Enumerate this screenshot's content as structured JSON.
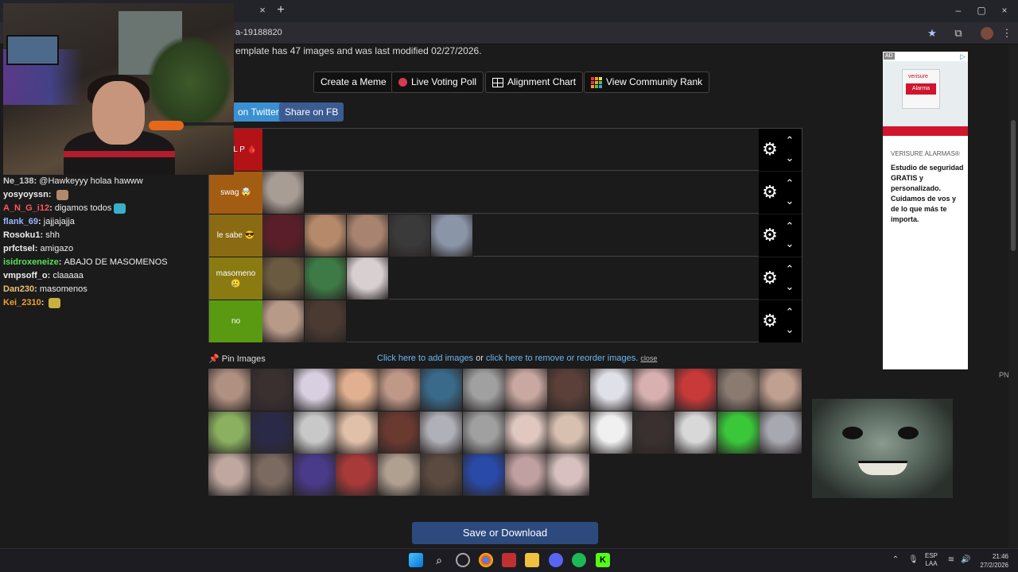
{
  "browser": {
    "url": "a-19188820",
    "tab_close": "×",
    "new_tab": "+",
    "window_controls": [
      "–",
      "▢",
      "×"
    ],
    "toolbar_icons": [
      "star-icon",
      "extensions-icon",
      "profile-icon",
      "menu-icon"
    ]
  },
  "page": {
    "template_info": "emplate has 47 images and was last modified 02/27/2026.",
    "actions": {
      "create_meme": "Create a Meme",
      "live_voting": "Live Voting Poll",
      "alignment_chart": "Alignment Chart",
      "community_rank": "View Community Rank"
    },
    "share": {
      "twitter": "on Twitter",
      "facebook": "Share on FB"
    },
    "tiers": [
      {
        "label": "S DEL P 🩸",
        "color": "#b31217",
        "items": [
          "#00000000"
        ]
      },
      {
        "label": "swag 🤯",
        "color": "#a35d12",
        "items": [
          "#a79d95"
        ]
      },
      {
        "label": "le sabe 😎",
        "color": "#8a6a12",
        "items": [
          "#5a1e2a",
          "#b58a6a",
          "#a88370",
          "#3a3a3a",
          "#8a95a8"
        ]
      },
      {
        "label": "masomeno 🥲",
        "color": "#8a7a12",
        "items": [
          "#6a5a40",
          "#3d7a45",
          "#d8d0d0"
        ]
      },
      {
        "label": "no",
        "color": "#5a9a12",
        "items": [
          "#b89a88",
          "#4a3a32"
        ]
      }
    ],
    "pin": {
      "label": "Pin Images",
      "add_link": "Click here to add images",
      "or": "or",
      "reorder_link": "click here to remove or reorder images.",
      "close": "close"
    },
    "pool": [
      "#b09080",
      "#3a3030",
      "#d8d0e0",
      "#e0b090",
      "#c09888",
      "#3a6a8a",
      "#a0a0a0",
      "#c8a8a0",
      "#5a4038",
      "#e0e0e8",
      "#d8b0b0",
      "#c83a3a",
      "#8a7a70",
      "#c0a090",
      "#8ab060",
      "#2a2a48",
      "#c8c8c8",
      "#e0c0a8",
      "#6a3a30",
      "#b0b0b8",
      "#a0a0a0",
      "#e0c8c0",
      "#d8c0b0",
      "#f0f0f0",
      "#3a3030",
      "#d8d8d8",
      "#3ac83a",
      "#a8a8b0",
      "#c0a8a0",
      "#7a6a60",
      "#4a3a8a",
      "#a83a3a",
      "#b0a090",
      "#5a4a40",
      "#2a4aa8",
      "#c0a0a0",
      "#d8c0c0"
    ],
    "save": "Save or Download"
  },
  "ad": {
    "badge": "AD",
    "choices": "▷",
    "brand_img": "verisure",
    "img_label": "Alarma",
    "sponsor": "VERISURE ALARMAS®",
    "copy": "Estudio de seguridad GRATIS y personalizado. Cuidamos de vos y de lo que más te importa."
  },
  "side_label": "PN",
  "chat": [
    {
      "user": "Ne_138",
      "msg": "@Hawkeyyy holaa hawww",
      "color": "#cfcfcf"
    },
    {
      "user": "yosyoyssn",
      "msg": "",
      "color": "#eeeeee",
      "emote": "#b08a6a"
    },
    {
      "user": "A_N_G_i12",
      "msg": "digamos todos",
      "color": "#ff5a5a",
      "emote": "#3ab0c8"
    },
    {
      "user": "flank_69",
      "msg": "jajjajajja",
      "color": "#9ab8ff"
    },
    {
      "user": "Rosoku1",
      "msg": "shh",
      "color": "#eeeeee"
    },
    {
      "user": "prfctsel",
      "msg": "amigazo",
      "color": "#eeeeee"
    },
    {
      "user": "isidroxeneize",
      "msg": "ABAJO DE MASOMENOS",
      "color": "#5ae05a"
    },
    {
      "user": "vmpsoff_o",
      "msg": "claaaaa",
      "color": "#eeeeee"
    },
    {
      "user": "Dan230",
      "msg": "masomenos",
      "color": "#f0c070"
    },
    {
      "user": "Kei_2310",
      "msg": "",
      "color": "#f0a030",
      "emote": "#c8b040"
    }
  ],
  "taskbar": {
    "lang": [
      "ESP",
      "LAA"
    ],
    "time": "21:46",
    "date": "27/2/2026",
    "icons": [
      "windows-icon",
      "search-icon",
      "app-icon",
      "chrome-icon",
      "video-icon",
      "folder-icon",
      "discord-icon",
      "spotify-icon",
      "kick-icon"
    ]
  },
  "colors": {
    "accent_blue": "#6ab7f2",
    "save_blue": "#2d4a7f",
    "share_blue": "#3b5b92"
  }
}
